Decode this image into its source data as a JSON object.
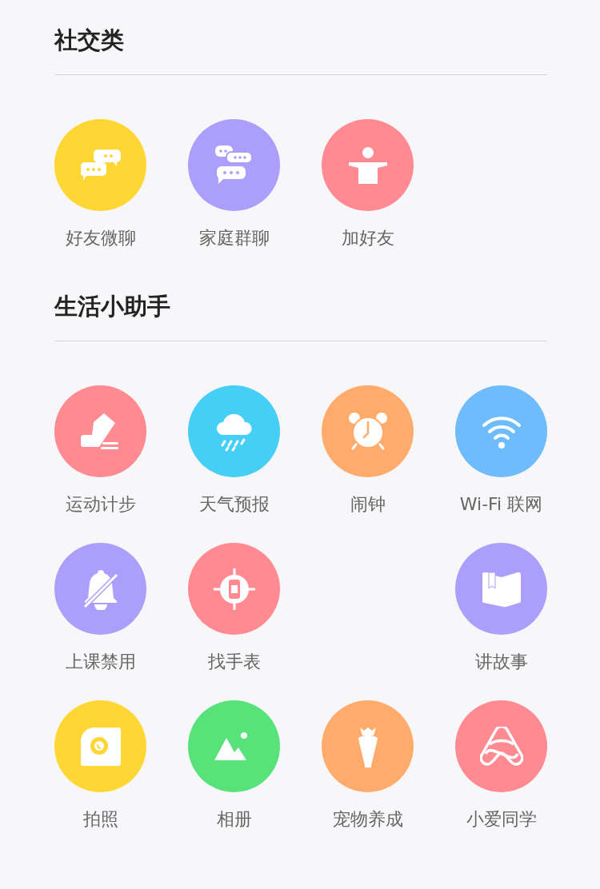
{
  "sections": [
    {
      "title": "社交类",
      "rows": [
        [
          {
            "label": "好友微聊",
            "color": "#ffd633"
          },
          {
            "label": "家庭群聊",
            "color": "#ab9ffb"
          },
          {
            "label": "加好友",
            "color": "#ff8a92"
          }
        ]
      ]
    },
    {
      "title": "生活小助手",
      "rows": [
        [
          {
            "label": "运动计步",
            "color": "#ff8a92"
          },
          {
            "label": "天气预报",
            "color": "#46cff5"
          },
          {
            "label": "闹钟",
            "color": "#ffab6c"
          },
          {
            "label": "Wi-Fi 联网",
            "color": "#6fbcfd"
          }
        ],
        [
          {
            "label": "上课禁用",
            "color": "#ab9ffb"
          },
          {
            "label": "找手表",
            "color": "#ff8a92"
          },
          null,
          {
            "label": "讲故事",
            "color": "#ab9ffb"
          }
        ],
        [
          {
            "label": "拍照",
            "color": "#ffd633"
          },
          {
            "label": "相册",
            "color": "#58e27a"
          },
          {
            "label": "宠物养成",
            "color": "#ffab6c"
          },
          {
            "label": "小爱同学",
            "color": "#ff8a92"
          }
        ]
      ]
    }
  ]
}
